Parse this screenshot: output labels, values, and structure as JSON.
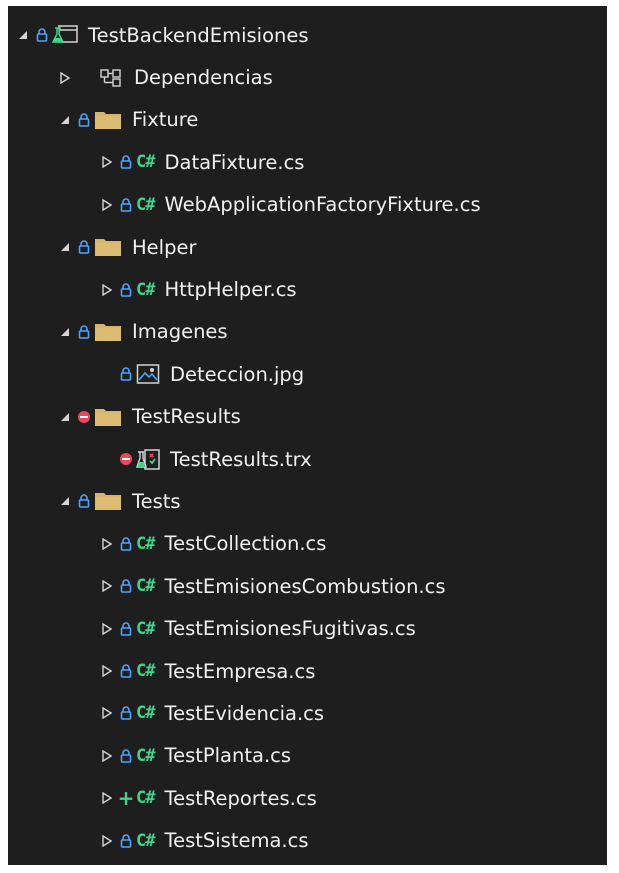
{
  "explorer": {
    "project": {
      "label": "TestBackendEmisiones"
    },
    "dependencies": {
      "label": "Dependencias"
    },
    "fixture": {
      "label": "Fixture",
      "files": [
        {
          "label": "DataFixture.cs"
        },
        {
          "label": "WebApplicationFactoryFixture.cs"
        }
      ]
    },
    "helper": {
      "label": "Helper",
      "files": [
        {
          "label": "HttpHelper.cs"
        }
      ]
    },
    "imagenes": {
      "label": "Imagenes",
      "files": [
        {
          "label": "Deteccion.jpg"
        }
      ]
    },
    "testresults": {
      "label": "TestResults",
      "files": [
        {
          "label": "TestResults.trx"
        }
      ]
    },
    "tests": {
      "label": "Tests",
      "files": [
        {
          "label": "TestCollection.cs"
        },
        {
          "label": "TestEmisionesCombustion.cs"
        },
        {
          "label": "TestEmisionesFugitivas.cs"
        },
        {
          "label": "TestEmpresa.cs"
        },
        {
          "label": "TestEvidencia.cs"
        },
        {
          "label": "TestPlanta.cs"
        },
        {
          "label": "TestReportes.cs"
        },
        {
          "label": "TestSistema.cs"
        }
      ]
    },
    "icons": {
      "expanded": "triangle-down-icon",
      "collapsed": "triangle-right-icon",
      "lock": "lock-icon",
      "excluded": "excluded-icon",
      "added": "plus-icon",
      "folder": "folder-icon",
      "csharp": "csharp-file-icon",
      "image": "image-file-icon",
      "trx": "test-results-file-icon",
      "project": "test-project-icon",
      "dependencies": "dependencies-icon"
    },
    "csharp_glyph": "C#",
    "plus_glyph": "+",
    "colors": {
      "background": "#1e1e1e",
      "text": "#f1f1f1",
      "lock": "#4ea3ff",
      "csharp": "#3fd48a",
      "folder": "#d8b56a",
      "excluded": "#f0465a",
      "added": "#3fd48a"
    }
  }
}
